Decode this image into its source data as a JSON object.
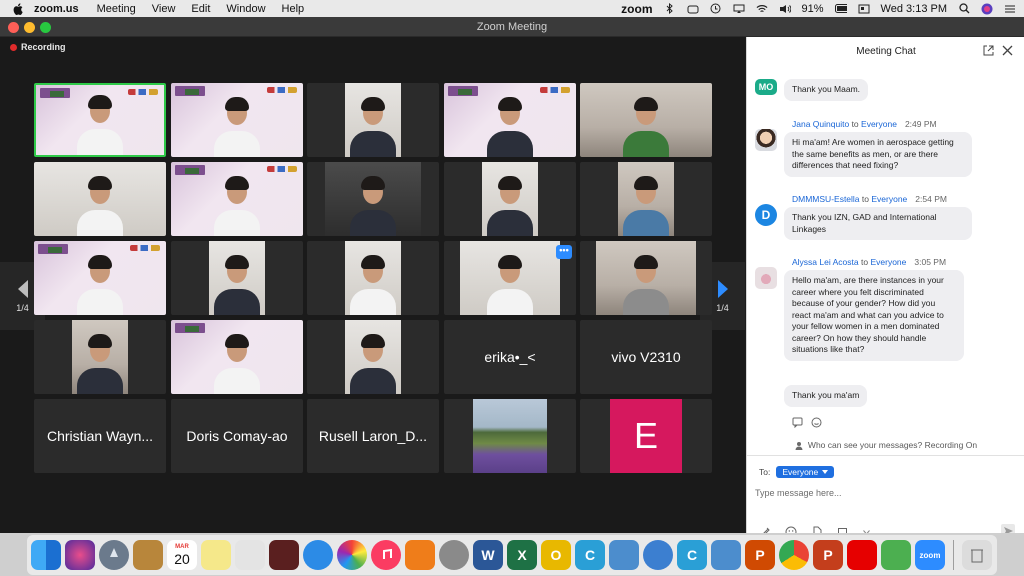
{
  "menubar": {
    "app_name": "zoom.us",
    "menus": [
      "Meeting",
      "View",
      "Edit",
      "Window",
      "Help"
    ],
    "status_app": "zoom",
    "battery": "91%",
    "clock": "Wed 3:13 PM"
  },
  "window": {
    "title": "Zoom Meeting",
    "recording_label": "Recording"
  },
  "gallery": {
    "page_left": "1/4",
    "page_right": "1/4",
    "name_tiles": {
      "erika": "erika•_<",
      "vivo": "vivo V2310",
      "christian": "Christian Wayn...",
      "doris": "Doris Comay-ao",
      "rusell": "Rusell Laron_D...",
      "e_initial": "E"
    },
    "more_button": "•••"
  },
  "chat": {
    "header": "Meeting Chat",
    "messages": [
      {
        "avatar": "MO",
        "text": "Thank you Maam."
      },
      {
        "sender": "Jana Quinquito",
        "to": "to",
        "recipient": "Everyone",
        "time": "2:49 PM",
        "text": "Hi ma'am! Are women in aerospace getting the same benefits as men, or are there differences that need fixing?"
      },
      {
        "avatar": "D",
        "sender": "DMMMSU-Estella",
        "to": "to",
        "recipient": "Everyone",
        "time": "2:54 PM",
        "text": "Thank you IZN, GAD and International Linkages"
      },
      {
        "sender": "Alyssa Lei Acosta",
        "to": "to",
        "recipient": "Everyone",
        "time": "3:05 PM",
        "text": "Hello ma'am, are there instances in your career where you felt discriminated because of your gender? How did you react ma'am and what can you advice to your fellow women in a men dominated career? On how they should handle situations like that?",
        "text2": "Thank you ma'am"
      }
    ],
    "visibility_note": "Who can see your messages? Recording On",
    "to_label": "To:",
    "recipient_button": "Everyone",
    "input_placeholder": "Type message here..."
  },
  "dock": {
    "calendar_month": "MAR",
    "calendar_day": "20",
    "zoom_label": "zoom"
  },
  "colors": {
    "zoom_blue": "#2d8cff",
    "active_speaker": "#2ec948",
    "recording_red": "#e02b2b",
    "avatar_e": "#d6185e"
  }
}
